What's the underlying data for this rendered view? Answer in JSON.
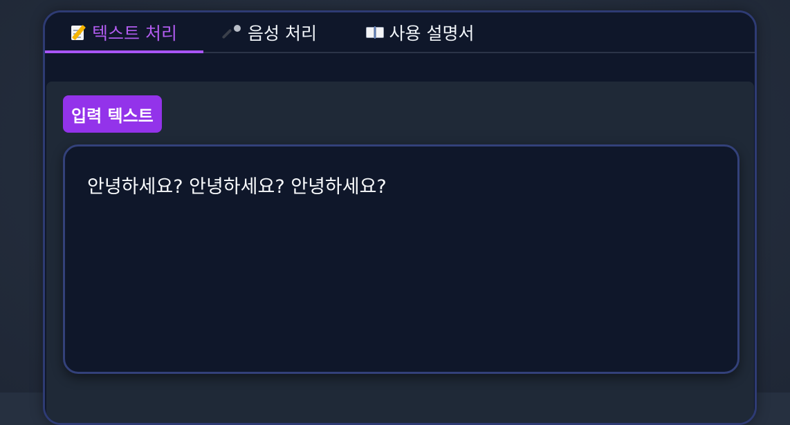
{
  "tabs": [
    {
      "emoji": "📝",
      "icon": "memo-icon",
      "label": "텍스트 처리",
      "active": true
    },
    {
      "emoji": "🎤",
      "icon": "microphone-icon",
      "label": "음성 처리",
      "active": false
    },
    {
      "emoji": "📖",
      "icon": "open-book-icon",
      "label": "사용 설명서",
      "active": false
    }
  ],
  "input_section": {
    "label": "입력 텍스트",
    "value": "안녕하세요? 안녕하세요? 안녕하세요?"
  },
  "colors": {
    "accent": "#a855f7",
    "active_tab_text": "#b25cf0",
    "panel_bg": "#0f172a",
    "content_bg": "#1f2937",
    "border": "#2e3b74"
  }
}
